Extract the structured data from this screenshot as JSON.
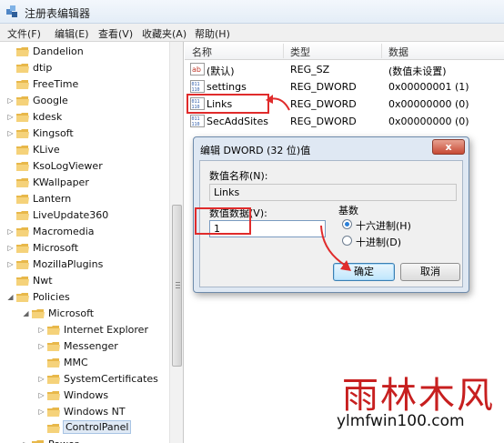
{
  "window": {
    "title": "注册表编辑器"
  },
  "menu": [
    "文件(F)",
    "编辑(E)",
    "查看(V)",
    "收藏夹(A)",
    "帮助(H)"
  ],
  "tree": {
    "items": [
      {
        "label": "Dandelion",
        "level": 1,
        "expander": "none"
      },
      {
        "label": "dtip",
        "level": 1,
        "expander": "none"
      },
      {
        "label": "FreeTime",
        "level": 1,
        "expander": "none"
      },
      {
        "label": "Google",
        "level": 1,
        "expander": "collapsed"
      },
      {
        "label": "kdesk",
        "level": 1,
        "expander": "collapsed"
      },
      {
        "label": "Kingsoft",
        "level": 1,
        "expander": "collapsed"
      },
      {
        "label": "KLive",
        "level": 1,
        "expander": "none"
      },
      {
        "label": "KsoLogViewer",
        "level": 1,
        "expander": "none"
      },
      {
        "label": "KWallpaper",
        "level": 1,
        "expander": "none"
      },
      {
        "label": "Lantern",
        "level": 1,
        "expander": "none"
      },
      {
        "label": "LiveUpdate360",
        "level": 1,
        "expander": "none"
      },
      {
        "label": "Macromedia",
        "level": 1,
        "expander": "collapsed"
      },
      {
        "label": "Microsoft",
        "level": 1,
        "expander": "collapsed"
      },
      {
        "label": "MozillaPlugins",
        "level": 1,
        "expander": "collapsed"
      },
      {
        "label": "Nwt",
        "level": 1,
        "expander": "none"
      },
      {
        "label": "Policies",
        "level": 1,
        "expander": "expanded"
      },
      {
        "label": "Microsoft",
        "level": 2,
        "expander": "expanded"
      },
      {
        "label": "Internet Explorer",
        "level": 3,
        "expander": "collapsed"
      },
      {
        "label": "Messenger",
        "level": 3,
        "expander": "collapsed"
      },
      {
        "label": "MMC",
        "level": 3,
        "expander": "none"
      },
      {
        "label": "SystemCertificates",
        "level": 3,
        "expander": "collapsed"
      },
      {
        "label": "Windows",
        "level": 3,
        "expander": "collapsed"
      },
      {
        "label": "Windows NT",
        "level": 3,
        "expander": "collapsed"
      },
      {
        "label": "ControlPanel",
        "level": 3,
        "expander": "none",
        "selected": true
      },
      {
        "label": "Power",
        "level": 2,
        "expander": "collapsed"
      }
    ]
  },
  "list": {
    "columns": [
      "名称",
      "类型",
      "数据"
    ],
    "rows": [
      {
        "icon": "string-value-icon",
        "name": "(默认)",
        "type": "REG_SZ",
        "data": "(数值未设置)"
      },
      {
        "icon": "dword-value-icon",
        "name": "settings",
        "type": "REG_DWORD",
        "data": "0x00000001 (1)"
      },
      {
        "icon": "dword-value-icon",
        "name": "Links",
        "type": "REG_DWORD",
        "data": "0x00000000 (0)"
      },
      {
        "icon": "dword-value-icon",
        "name": "SecAddSites",
        "type": "REG_DWORD",
        "data": "0x00000000 (0)"
      }
    ]
  },
  "dialog": {
    "title": "编辑 DWORD (32 位)值",
    "close_label": "x",
    "name_label": "数值名称(N):",
    "name_value": "Links",
    "data_label": "数值数据(V):",
    "data_value": "1",
    "base_label": "基数",
    "hex_label": "十六进制(H)",
    "dec_label": "十进制(D)",
    "ok_label": "确定",
    "cancel_label": "取消"
  },
  "watermark": {
    "text": "雨林木风",
    "url": "ylmfwin100.com"
  },
  "colors": {
    "annotation": "#e02b2b",
    "selection": "#dfe9f5",
    "folder": "#e8b84a"
  }
}
